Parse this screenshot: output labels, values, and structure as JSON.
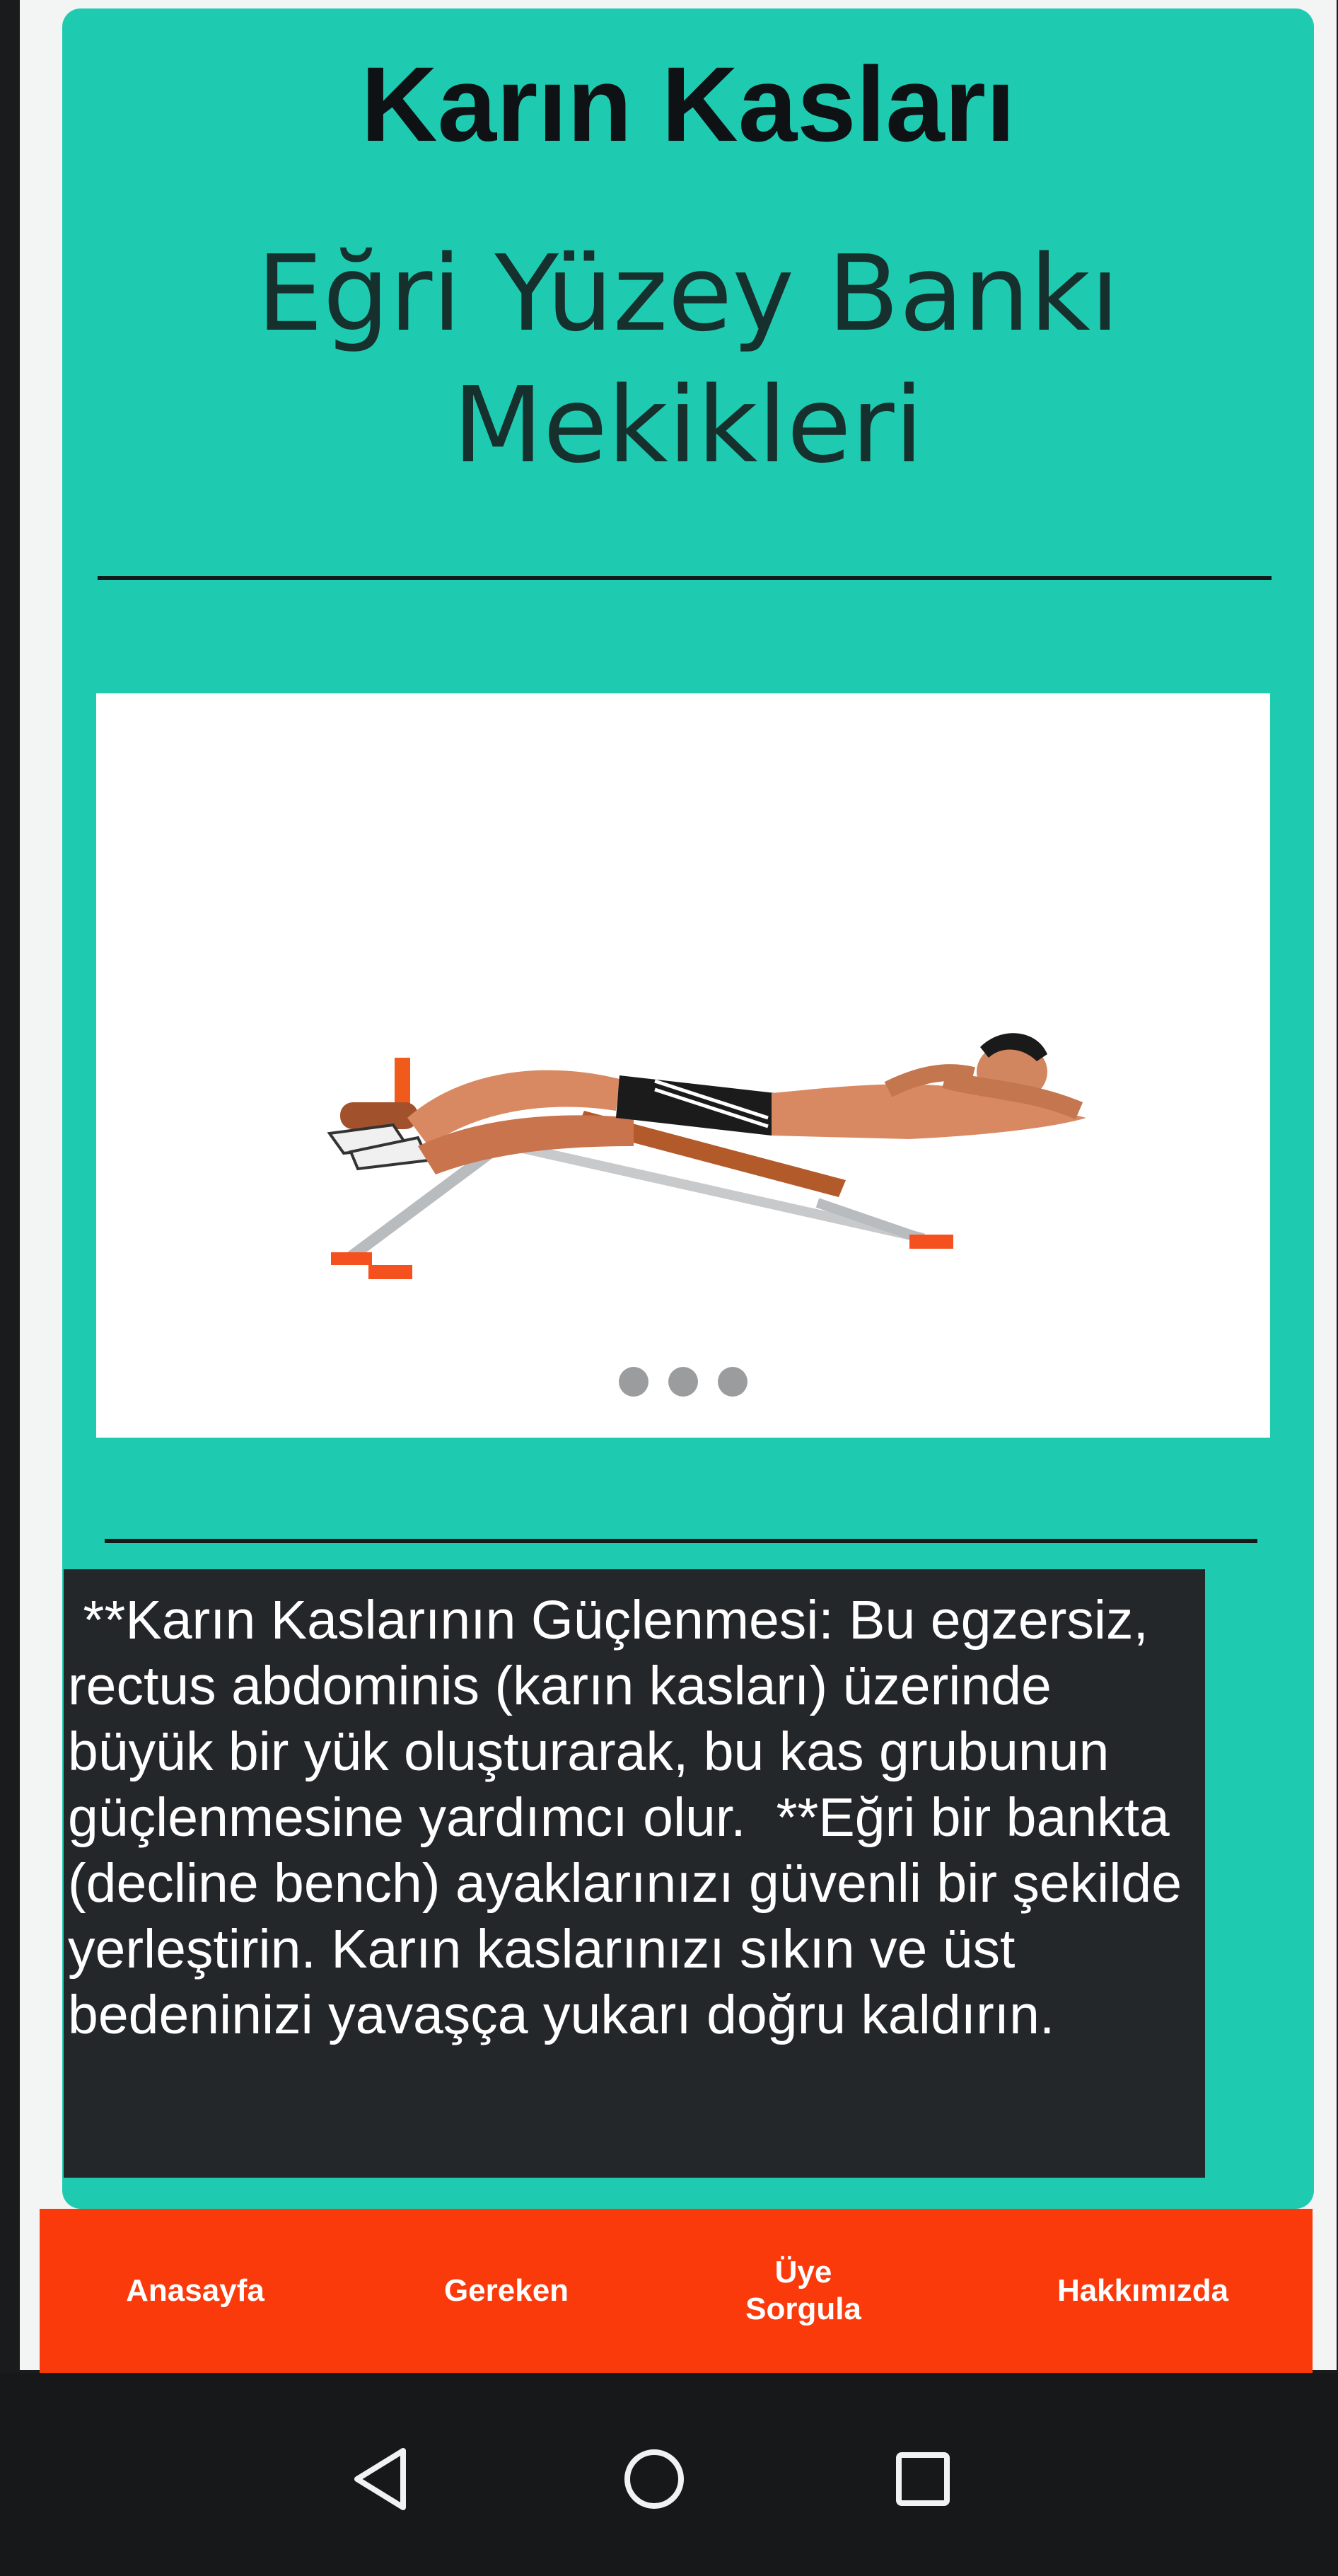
{
  "header": {
    "title": "Karın Kasları"
  },
  "exercise": {
    "name": "Eğri Yüzey Bankı Mekikleri",
    "image_description": "",
    "carousel_pages": 3
  },
  "description": {
    "text": " **Karın Kaslarının Güçlenmesi: Bu egzersiz, rectus abdominis (karın kasları) üzerinde büyük bir yük oluşturarak, bu kas grubunun güçlenmesine yardımcı olur.  **Eğri bir bankta (decline bench) ayaklarınızı güvenli bir şekilde yerleştirin. Karın kaslarınızı sıkın ve üst bedeninizi yavaşça yukarı doğru kaldırın."
  },
  "bottom_nav": {
    "items": [
      {
        "label": "Anasayfa"
      },
      {
        "label": "Gereken"
      },
      {
        "label": "Üye\nSorgula"
      },
      {
        "label": "Hakkımızda"
      }
    ]
  },
  "system_nav": {
    "back_icon": "triangle-back-icon",
    "home_icon": "circle-home-icon",
    "recent_icon": "square-recents-icon"
  },
  "colors": {
    "card_background": "#1ecbb1",
    "description_background": "#24272a",
    "bottom_nav_background": "#fb3a0c",
    "system_nav_background": "#17181a"
  }
}
